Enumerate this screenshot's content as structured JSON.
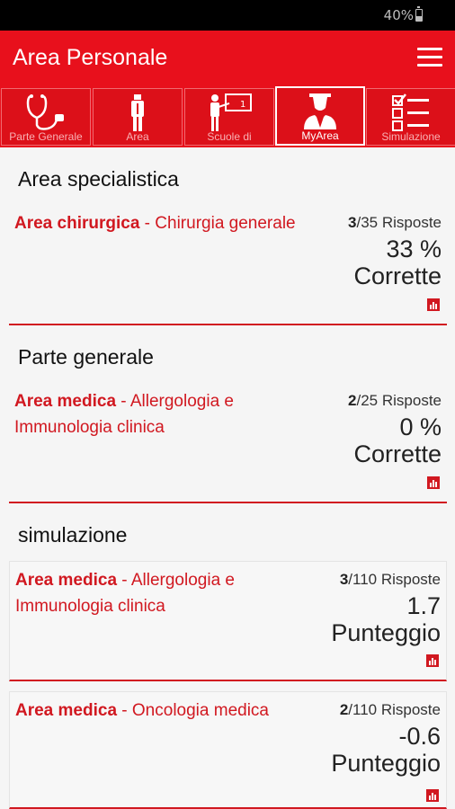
{
  "status_bar": {
    "battery_text": "40%"
  },
  "app_bar": {
    "title": "Area Personale",
    "menu_icon": "hamburger-menu-icon"
  },
  "tabs": [
    {
      "label": "Parte Generale",
      "icon": "stethoscope-icon",
      "active": false
    },
    {
      "label": "Area",
      "icon": "person-icon",
      "active": false
    },
    {
      "label": "Scuole di",
      "icon": "teacher-board-icon",
      "active": false
    },
    {
      "label": "MyArea",
      "icon": "user-profile-icon",
      "active": true
    },
    {
      "label": "Simulazione",
      "icon": "checklist-icon",
      "active": false
    }
  ],
  "sections": [
    {
      "title": "Area specialistica",
      "cards": [
        {
          "area": "Area chirurgica",
          "separator": " - ",
          "specialty": "Chirurgia generale",
          "answered": "3",
          "total": "/35 Risposte",
          "value": "33 %",
          "metric": "Corrette"
        }
      ]
    },
    {
      "title": "Parte generale",
      "cards": [
        {
          "area": "Area medica",
          "separator": " - ",
          "specialty": "Allergologia e Immunologia clinica",
          "answered": "2",
          "total": "/25 Risposte",
          "value": "0 %",
          "metric": "Corrette"
        }
      ]
    },
    {
      "title": "simulazione",
      "cards": [
        {
          "area": "Area medica",
          "separator": " - ",
          "specialty": "Allergologia e Immunologia clinica",
          "answered": "3",
          "total": "/110 Risposte",
          "value": "1.7",
          "metric": "Punteggio"
        },
        {
          "area": "Area medica",
          "separator": " - ",
          "specialty": "Oncologia medica",
          "answered": "2",
          "total": "/110 Risposte",
          "value": "-0.6",
          "metric": "Punteggio"
        }
      ]
    }
  ],
  "colors": {
    "brand_red": "#e8101c",
    "accent_red": "#d11820"
  }
}
